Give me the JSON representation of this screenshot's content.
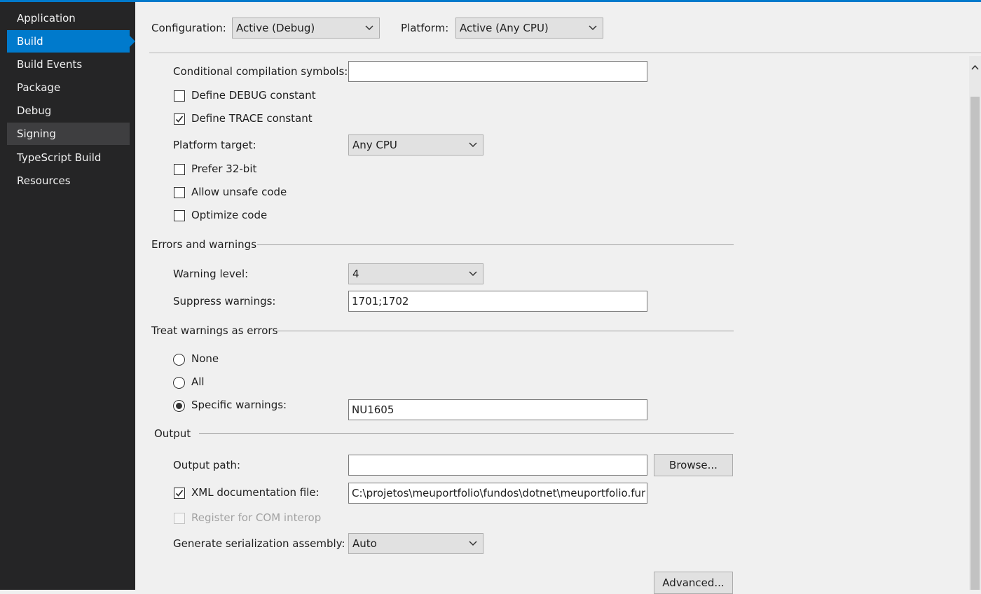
{
  "sidebar": {
    "items": [
      {
        "label": "Application"
      },
      {
        "label": "Build"
      },
      {
        "label": "Build Events"
      },
      {
        "label": "Package"
      },
      {
        "label": "Debug"
      },
      {
        "label": "Signing"
      },
      {
        "label": "TypeScript Build"
      },
      {
        "label": "Resources"
      }
    ],
    "active": "Build"
  },
  "header": {
    "configuration_label": "Configuration:",
    "configuration_value": "Active (Debug)",
    "platform_label": "Platform:",
    "platform_value": "Active (Any CPU)"
  },
  "general": {
    "symbols_label": "Conditional compilation symbols:",
    "symbols_value": "",
    "define_debug_label": "Define DEBUG constant",
    "define_debug_checked": false,
    "define_trace_label": "Define TRACE constant",
    "define_trace_checked": true,
    "platform_target_label": "Platform target:",
    "platform_target_value": "Any CPU",
    "prefer32_label": "Prefer 32-bit",
    "unsafe_label": "Allow unsafe code",
    "optimize_label": "Optimize code"
  },
  "errors": {
    "heading": "Errors and warnings",
    "warning_level_label": "Warning level:",
    "warning_level_value": "4",
    "suppress_label": "Suppress warnings:",
    "suppress_value": "1701;1702"
  },
  "treat": {
    "heading": "Treat warnings as errors",
    "none_label": "None",
    "all_label": "All",
    "specific_label": "Specific warnings:",
    "specific_value": "NU1605",
    "selected": "Specific warnings:"
  },
  "output": {
    "heading": "Output",
    "path_label": "Output path:",
    "path_value": "",
    "browse_label": "Browse...",
    "xml_label": "XML documentation file:",
    "xml_checked": true,
    "xml_value": "C:\\projetos\\meuportfolio\\fundos\\dotnet\\meuportfolio.fundos",
    "com_label": "Register for COM interop",
    "com_enabled": false,
    "serialization_label": "Generate serialization assembly:",
    "serialization_value": "Auto",
    "advanced_label": "Advanced..."
  },
  "colors": {
    "accent": "#007acc",
    "sidebar_bg": "#252526",
    "content_bg": "#f0f0f0"
  }
}
